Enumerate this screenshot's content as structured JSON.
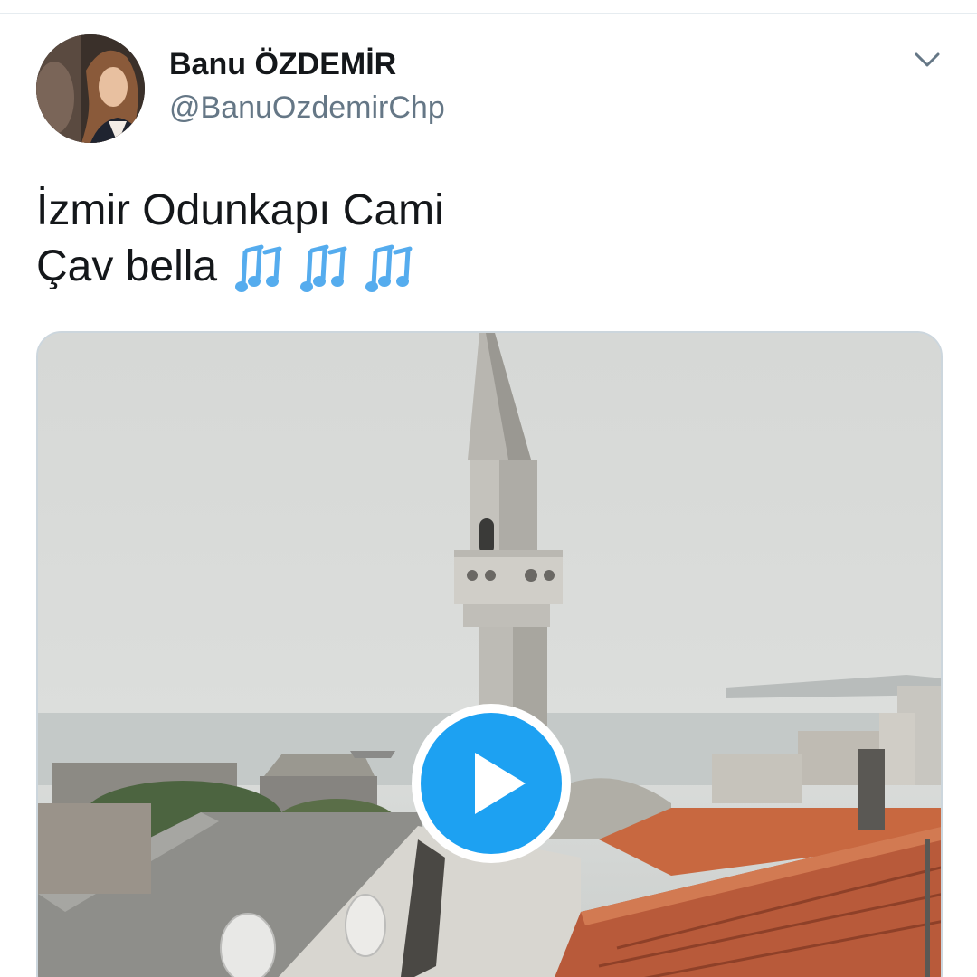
{
  "tweet": {
    "author": {
      "display_name": "Banu ÖZDEMİR",
      "handle": "@BanuOzdemirChp",
      "avatar_icon": "profile-photo"
    },
    "menu_icon": "chevron-down-icon",
    "text_lines": [
      "İzmir Odunkapı Cami",
      "Çav bella"
    ],
    "emoji": [
      "musical-notes-icon",
      "musical-notes-icon",
      "musical-notes-icon"
    ],
    "media": {
      "type": "video",
      "play_icon": "play-icon"
    }
  },
  "colors": {
    "accent": "#1da1f2",
    "text_primary": "#14171a",
    "text_secondary": "#657786",
    "border": "#ccd6dd",
    "emoji_blue": "#55acee"
  }
}
